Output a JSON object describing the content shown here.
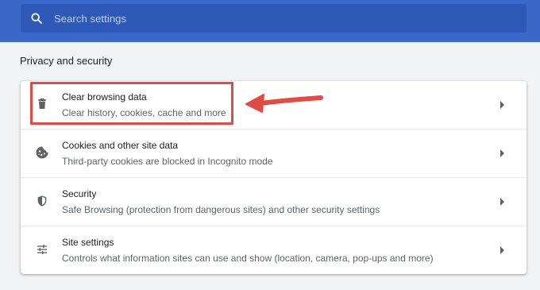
{
  "search": {
    "placeholder": "Search settings"
  },
  "section": {
    "title": "Privacy and security"
  },
  "rows": [
    {
      "title": "Clear browsing data",
      "subtitle": "Clear history, cookies, cache and more",
      "icon": "trash-icon"
    },
    {
      "title": "Cookies and other site data",
      "subtitle": "Third-party cookies are blocked in Incognito mode",
      "icon": "cookie-icon"
    },
    {
      "title": "Security",
      "subtitle": "Safe Browsing (protection from dangerous sites) and other security settings",
      "icon": "shield-icon"
    },
    {
      "title": "Site settings",
      "subtitle": "Controls what information sites can use and show (location, camera, pop-ups and more)",
      "icon": "sliders-icon"
    }
  ],
  "colors": {
    "header": "#3b67c9",
    "search_bg": "#2f59b8",
    "annotation": "#e24a45"
  }
}
